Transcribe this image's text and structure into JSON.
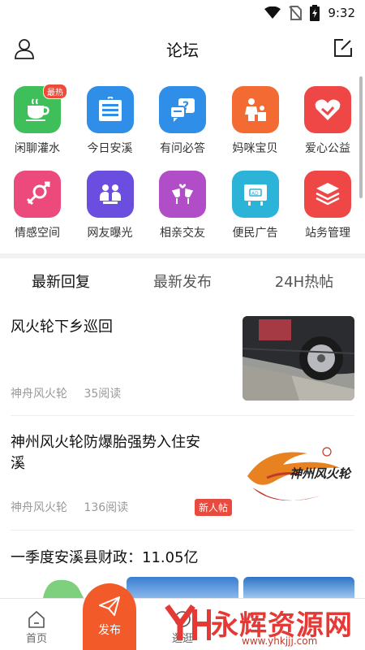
{
  "status": {
    "time": "9:32"
  },
  "header": {
    "title": "论坛"
  },
  "categories": [
    {
      "label": "闲聊灌水",
      "icon": "teacup-icon",
      "color": "#3fbf5a",
      "badge": "最热"
    },
    {
      "label": "今日安溪",
      "icon": "newspaper-icon",
      "color": "#2f8fe8"
    },
    {
      "label": "有问必答",
      "icon": "question-bubble-icon",
      "color": "#2f8fe8"
    },
    {
      "label": "妈咪宝贝",
      "icon": "mother-child-icon",
      "color": "#f36b32"
    },
    {
      "label": "爱心公益",
      "icon": "heart-hands-icon",
      "color": "#ef4646"
    },
    {
      "label": "情感空间",
      "icon": "gender-icon",
      "color": "#ec4a7c"
    },
    {
      "label": "网友曝光",
      "icon": "group-icon",
      "color": "#6b4ee0"
    },
    {
      "label": "相亲交友",
      "icon": "wine-glasses-icon",
      "color": "#b14dc7"
    },
    {
      "label": "便民广告",
      "icon": "ad-board-icon",
      "color": "#2bb4d8"
    },
    {
      "label": "站务管理",
      "icon": "layers-icon",
      "color": "#ef4646"
    }
  ],
  "tabs": [
    {
      "label": "最新回复",
      "active": true
    },
    {
      "label": "最新发布",
      "active": false
    },
    {
      "label": "24H热帖",
      "active": false
    }
  ],
  "posts": [
    {
      "title": "风火轮下乡巡回",
      "author": "神舟风火轮",
      "reads": "35阅读"
    },
    {
      "title_line1": "神州风火轮防爆胎强势入住安",
      "title_line2": "溪",
      "author": "神舟风火轮",
      "reads": "136阅读",
      "badge": "新人帖",
      "logo_text": "神州风火轮"
    },
    {
      "title": "一季度安溪县财政：11.05亿"
    }
  ],
  "bottom_nav": [
    {
      "label": "首页"
    },
    {
      "label": "发布"
    },
    {
      "label": "逛逛"
    }
  ],
  "watermark": {
    "text": "永辉资源网",
    "url": "www.yhkjjj.com"
  }
}
